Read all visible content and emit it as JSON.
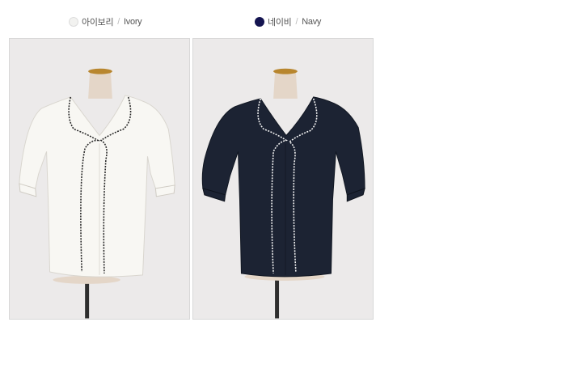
{
  "variants": [
    {
      "name_ko": "아이보리",
      "separator": "/",
      "name_en": "Ivory",
      "swatch_color": "#f2f2f0",
      "garment_color": "#f8f7f3",
      "trim_color": "#2a2a2a"
    },
    {
      "name_ko": "네이비",
      "separator": "/",
      "name_en": "Navy",
      "swatch_color": "#141450",
      "garment_color": "#1c2333",
      "trim_color": "#f4f4f4"
    }
  ],
  "colors": {
    "photo_background": "#eceaea",
    "mannequin_neck": "#e4d6c8",
    "mannequin_cap": "#b8862e",
    "stand": "#2e2e2e"
  }
}
